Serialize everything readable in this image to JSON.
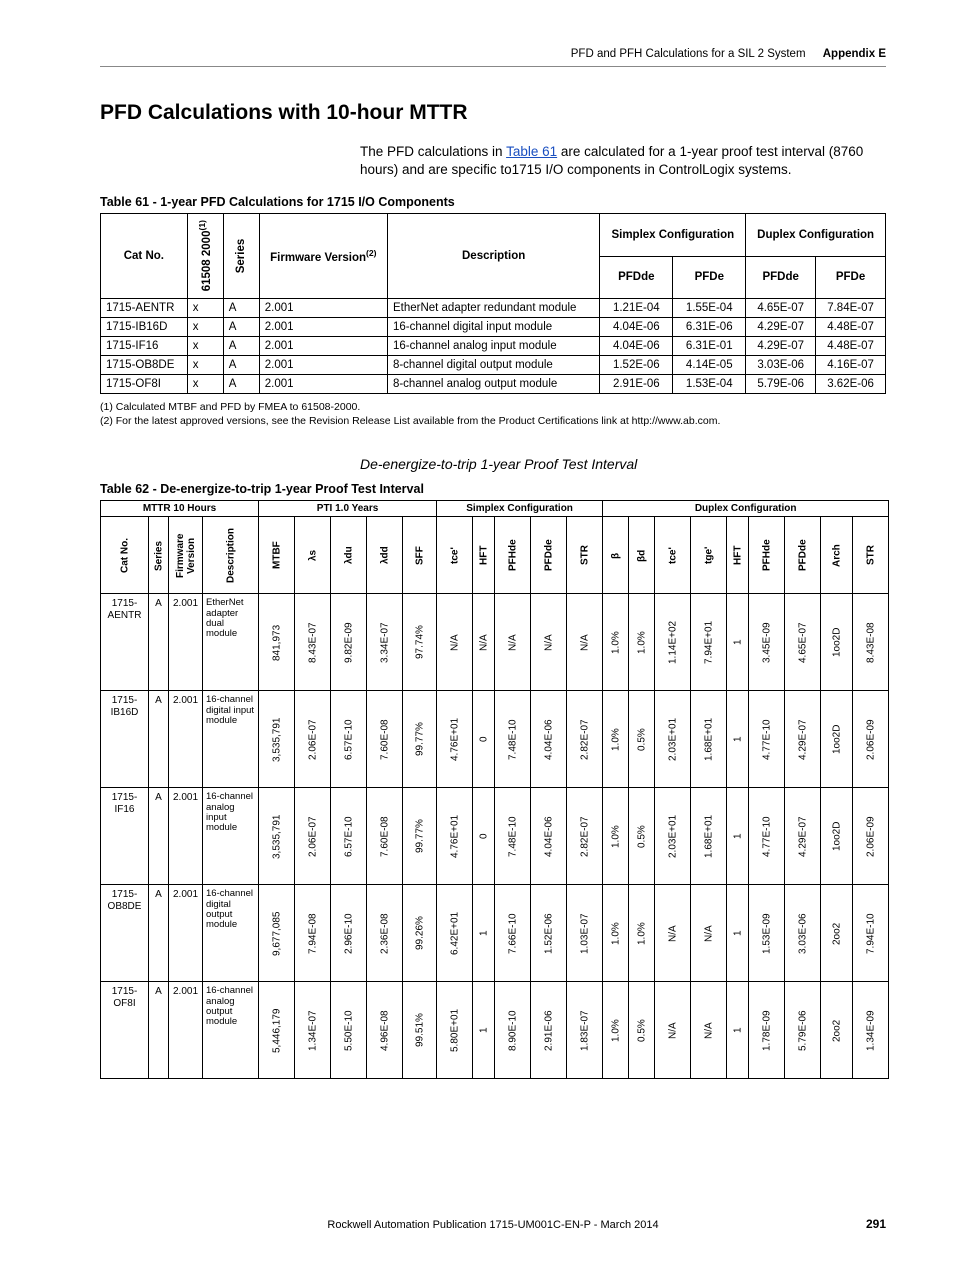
{
  "running_head": {
    "title": "PFD and PFH Calculations for a SIL 2 System",
    "appendix": "Appendix E"
  },
  "section_title": "PFD Calculations with 10-hour MTTR",
  "intro_before_link": "The PFD calculations in ",
  "intro_link": "Table 61",
  "intro_after_link": " are calculated for a 1-year proof test interval (8760 hours) and are specific to1715 I/O components in ControlLogix systems.",
  "t61": {
    "caption": "Table 61 - 1-year PFD Calculations for 1715 I/O Components",
    "head": {
      "cat": "Cat No.",
      "c61508": "61508 2000",
      "c61508_sup": "(1)",
      "series": "Series",
      "fw": "Firmware Version",
      "fw_sup": "(2)",
      "desc": "Description",
      "simplex": "Simplex Configuration",
      "duplex": "Duplex Configuration",
      "pfdde": "PFDde",
      "pfde": "PFDe"
    },
    "rows": [
      {
        "cat": "1715-AENTR",
        "x": "x",
        "series": "A",
        "fw": "2.001",
        "desc": "EtherNet adapter redundant module",
        "s_pfdde": "1.21E-04",
        "s_pfde": "1.55E-04",
        "d_pfdde": "4.65E-07",
        "d_pfde": "7.84E-07"
      },
      {
        "cat": "1715-IB16D",
        "x": "x",
        "series": "A",
        "fw": "2.001",
        "desc": "16-channel digital input module",
        "s_pfdde": "4.04E-06",
        "s_pfde": "6.31E-06",
        "d_pfdde": "4.29E-07",
        "d_pfde": "4.48E-07"
      },
      {
        "cat": "1715-IF16",
        "x": "x",
        "series": "A",
        "fw": "2.001",
        "desc": "16-channel analog input module",
        "s_pfdde": "4.04E-06",
        "s_pfde": "6.31E-01",
        "d_pfdde": "4.29E-07",
        "d_pfde": "4.48E-07"
      },
      {
        "cat": "1715-OB8DE",
        "x": "x",
        "series": "A",
        "fw": "2.001",
        "desc": "8-channel digital output module",
        "s_pfdde": "1.52E-06",
        "s_pfde": "4.14E-05",
        "d_pfdde": "3.03E-06",
        "d_pfde": "4.16E-07"
      },
      {
        "cat": "1715-OF8I",
        "x": "x",
        "series": "A",
        "fw": "2.001",
        "desc": "8-channel analog output module",
        "s_pfdde": "2.91E-06",
        "s_pfde": "1.53E-04",
        "d_pfdde": "5.79E-06",
        "d_pfde": "3.62E-06"
      }
    ]
  },
  "footnotes": {
    "f1": "(1)   Calculated MTBF and PFD by FMEA to 61508-2000.",
    "f2": "(2)   For the latest approved versions, see the Revision Release List available from the Product Certifications link at http://www.ab.com."
  },
  "sub_italic": "De-energize-to-trip 1-year Proof Test Interval",
  "t62": {
    "caption": "Table 62 - De-energize-to-trip 1-year Proof Test Interval",
    "head1": {
      "mttr": "MTTR 10 Hours",
      "pti": "PTI 1.0 Years",
      "simplex": "Simplex Configuration",
      "duplex": "Duplex Configuration"
    },
    "cols": [
      "Cat No.",
      "Series",
      "Firmware Version",
      "Description",
      "MTBF",
      "λs",
      "λdu",
      "λdd",
      "SFF",
      "tce'",
      "HFT",
      "PFHde",
      "PFDde",
      "STR",
      "β",
      "βd",
      "tce'",
      "tge'",
      "HFT",
      "PFHde",
      "PFDde",
      "Arch",
      "STR"
    ],
    "rows": [
      {
        "cat": "1715-AENTR",
        "series": "A",
        "fw": "2.001",
        "desc": "EtherNet adapter dual module",
        "MTBF": "841,973",
        "ls": "8.43E-07",
        "ldu": "9.82E-09",
        "ldd": "3.34E-07",
        "SFF": "97.74%",
        "s_tce": "N/A",
        "s_HFT": "N/A",
        "s_PFHde": "N/A",
        "s_PFDde": "N/A",
        "s_STR": "N/A",
        "beta": "1.0%",
        "betad": "1.0%",
        "d_tce": "1.14E+02",
        "d_tge": "7.94E+01",
        "d_HFT": "1",
        "d_PFHde": "3.45E-09",
        "d_PFDde": "4.65E-07",
        "Arch": "1oo2D",
        "d_STR": "8.43E-08"
      },
      {
        "cat": "1715-IB16D",
        "series": "A",
        "fw": "2.001",
        "desc": "16-channel digital input module",
        "MTBF": "3,535,791",
        "ls": "2.06E-07",
        "ldu": "6.57E-10",
        "ldd": "7.60E-08",
        "SFF": "99.77%",
        "s_tce": "4.76E+01",
        "s_HFT": "0",
        "s_PFHde": "7.48E-10",
        "s_PFDde": "4.04E-06",
        "s_STR": "2.82E-07",
        "beta": "1.0%",
        "betad": "0.5%",
        "d_tce": "2.03E+01",
        "d_tge": "1.68E+01",
        "d_HFT": "1",
        "d_PFHde": "4.77E-10",
        "d_PFDde": "4.29E-07",
        "Arch": "1oo2D",
        "d_STR": "2.06E-09"
      },
      {
        "cat": "1715-IF16",
        "series": "A",
        "fw": "2.001",
        "desc": "16-channel analog input module",
        "MTBF": "3,535,791",
        "ls": "2.06E-07",
        "ldu": "6.57E-10",
        "ldd": "7.60E-08",
        "SFF": "99.77%",
        "s_tce": "4.76E+01",
        "s_HFT": "0",
        "s_PFHde": "7.48E-10",
        "s_PFDde": "4.04E-06",
        "s_STR": "2.82E-07",
        "beta": "1.0%",
        "betad": "0.5%",
        "d_tce": "2.03E+01",
        "d_tge": "1.68E+01",
        "d_HFT": "1",
        "d_PFHde": "4.77E-10",
        "d_PFDde": "4.29E-07",
        "Arch": "1oo2D",
        "d_STR": "2.06E-09"
      },
      {
        "cat": "1715-OB8DE",
        "series": "A",
        "fw": "2.001",
        "desc": "16-channel digital output module",
        "MTBF": "9,677,085",
        "ls": "7.94E-08",
        "ldu": "2.96E-10",
        "ldd": "2.36E-08",
        "SFF": "99.26%",
        "s_tce": "6.42E+01",
        "s_HFT": "1",
        "s_PFHde": "7.66E-10",
        "s_PFDde": "1.52E-06",
        "s_STR": "1.03E-07",
        "beta": "1.0%",
        "betad": "1.0%",
        "d_tce": "N/A",
        "d_tge": "N/A",
        "d_HFT": "1",
        "d_PFHde": "1.53E-09",
        "d_PFDde": "3.03E-06",
        "Arch": "2oo2",
        "d_STR": "7.94E-10"
      },
      {
        "cat": "1715-OF8I",
        "series": "A",
        "fw": "2.001",
        "desc": "16-channel analog output module",
        "MTBF": "5,446,179",
        "ls": "1.34E-07",
        "ldu": "5.50E-10",
        "ldd": "4.96E-08",
        "SFF": "99.51%",
        "s_tce": "5.80E+01",
        "s_HFT": "1",
        "s_PFHde": "8.90E-10",
        "s_PFDde": "2.91E-06",
        "s_STR": "1.83E-07",
        "beta": "1.0%",
        "betad": "0.5%",
        "d_tce": "N/A",
        "d_tge": "N/A",
        "d_HFT": "1",
        "d_PFHde": "1.78E-09",
        "d_PFDde": "5.79E-06",
        "Arch": "2oo2",
        "d_STR": "1.34E-09"
      }
    ]
  },
  "footer": {
    "pub": "Rockwell Automation Publication 1715-UM001C-EN-P - March 2014",
    "page": "291"
  }
}
